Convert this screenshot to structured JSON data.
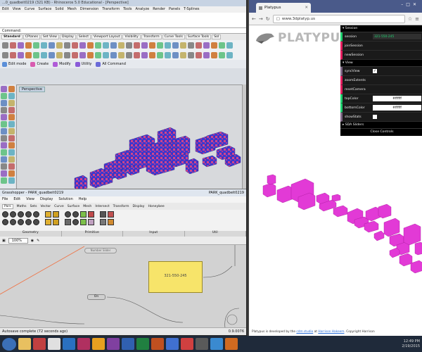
{
  "rhino": {
    "title": "...0_quadbeit0219 (321 KB) - Rhinoceros 5.0 Educational - [Perspective]",
    "menu": [
      "Edit",
      "View",
      "Curve",
      "Surface",
      "Solid",
      "Mesh",
      "Dimension",
      "Transform",
      "Tools",
      "Analyze",
      "Render",
      "Panels",
      "T-Splines"
    ],
    "command_label": "Command:",
    "tabs": [
      "Standard",
      "CPlanes",
      "Set View",
      "Display",
      "Select",
      "Viewport Layout",
      "Visibility",
      "Transform",
      "Curve Tools",
      "Surface Tools",
      "Sol"
    ],
    "toolbar2": [
      "Edit mode",
      "Create",
      "Modify",
      "Utility",
      "All Command"
    ],
    "viewport_label": "Perspective"
  },
  "grasshopper": {
    "title": "Grasshopper - PARK_quadbeit0219",
    "title_right": "PARK_quadbeit0219",
    "menu": [
      "File",
      "Edit",
      "View",
      "Display",
      "Solution",
      "Help"
    ],
    "tabs": [
      "Pars",
      "Maths",
      "Sets",
      "Vector",
      "Curve",
      "Surface",
      "Mesh",
      "Intersect",
      "Transform",
      "Display",
      "Honeybee"
    ],
    "groups": [
      "Geometry",
      "Primitive",
      "Input",
      "Util"
    ],
    "zoom": "100%",
    "panel_text": "321-550-245",
    "slider_text": "Number Slider",
    "node_text": "On",
    "status_left": "Autosave complete (72 seconds ago)",
    "status_right": "0.9.0076"
  },
  "browser": {
    "tab_title": "Platypus",
    "url": "www.3dplatyp.us",
    "logo_text": "PLATYPUS",
    "footer_prefix": "Platypus is developed by the ",
    "footer_link1": "cdm studio",
    "footer_mid": " at ",
    "footer_link2": "Harrison Hakeem",
    "footer_suffix": ". Copyright Harrison",
    "gui": {
      "folder_session": "Session",
      "session_label": "session",
      "session_value": "321-550-245",
      "join_label": "joinSession",
      "new_label": "newSession",
      "folder_view": "View",
      "sync_label": "syncView",
      "zoom_label": "zoomExtents",
      "reset_label": "resetCamera",
      "top_label": "topColor",
      "top_value": "#ffffff",
      "bottom_label": "bottomColor",
      "bottom_value": "#ffffff",
      "stats_label": "showStats",
      "folder_sda": "SDA Sliders",
      "close_label": "Close Controls"
    }
  },
  "taskbar": {
    "time": "12:49 PM",
    "date": "2/19/2015"
  },
  "colors": {
    "model_magenta": "#e23ad6",
    "rhino_blue": "#3a3ad0",
    "rhino_pink": "#d0458c",
    "gh_panel": "#f7e46a"
  }
}
